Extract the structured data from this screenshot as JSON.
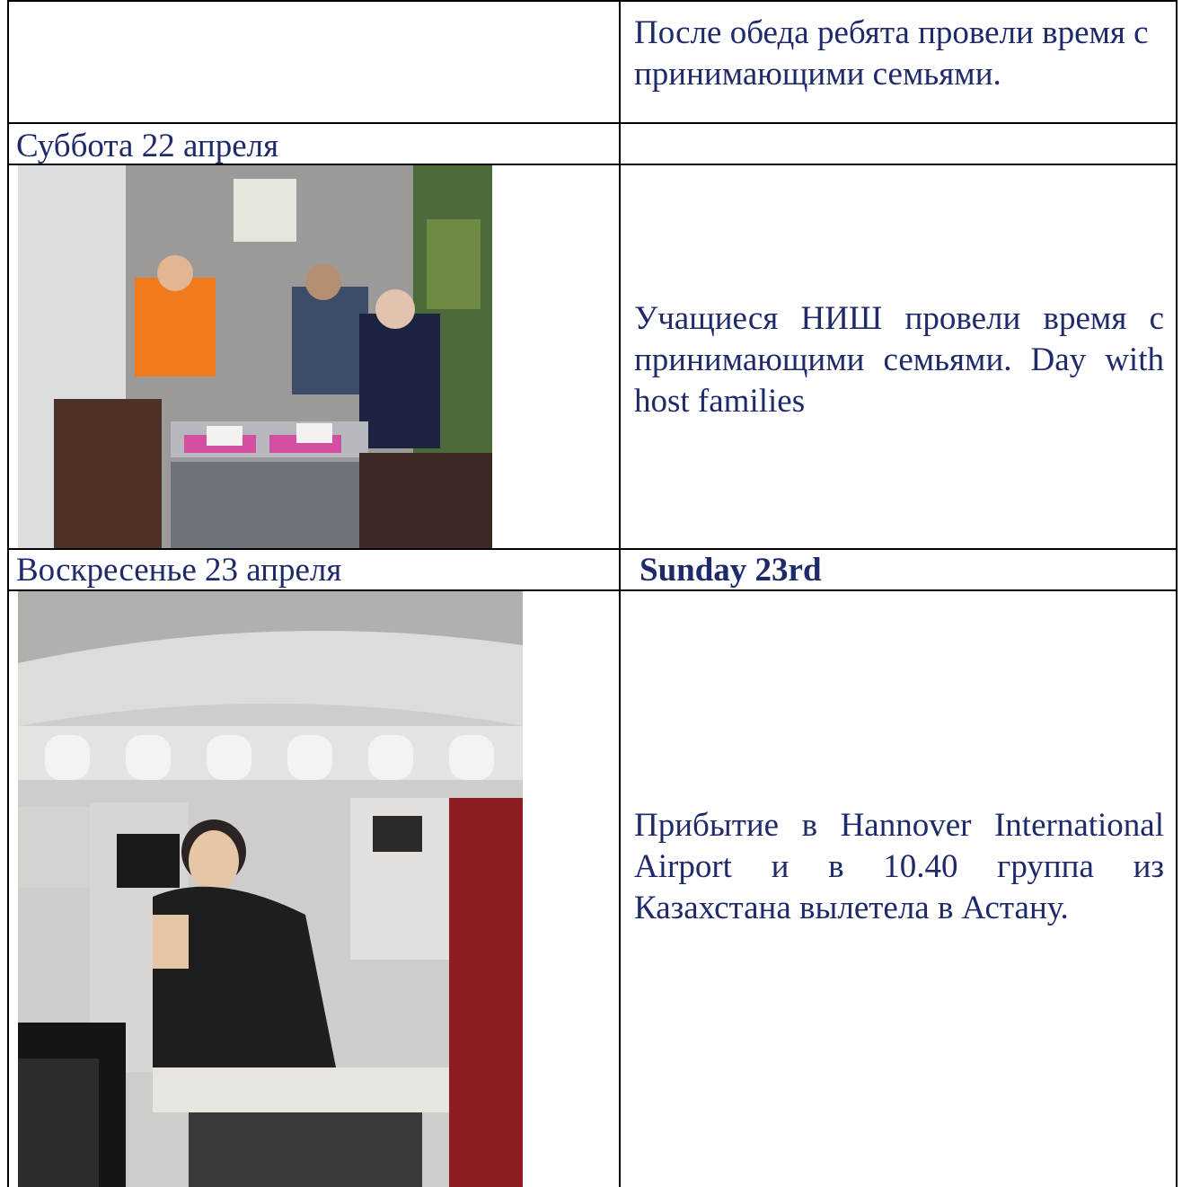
{
  "rows": [
    {
      "left_text": "",
      "right_text": "После обеда ребята провели время с принимающими семьями."
    },
    {
      "left_text": "Суббота 22 апреля",
      "right_text": ""
    },
    {
      "left_image": "family-dinner-photo",
      "right_text": "Учащиеся НИШ провели время с принимающими семьями. Day with host families"
    },
    {
      "left_text": "Воскресенье 23 апреля",
      "right_text": "Sunday 23rd"
    },
    {
      "left_image": "airplane-photo",
      "right_text": "Прибытие в Hannover International Airport и в 10.40 группа из Казахстана вылетела в Астану."
    }
  ]
}
